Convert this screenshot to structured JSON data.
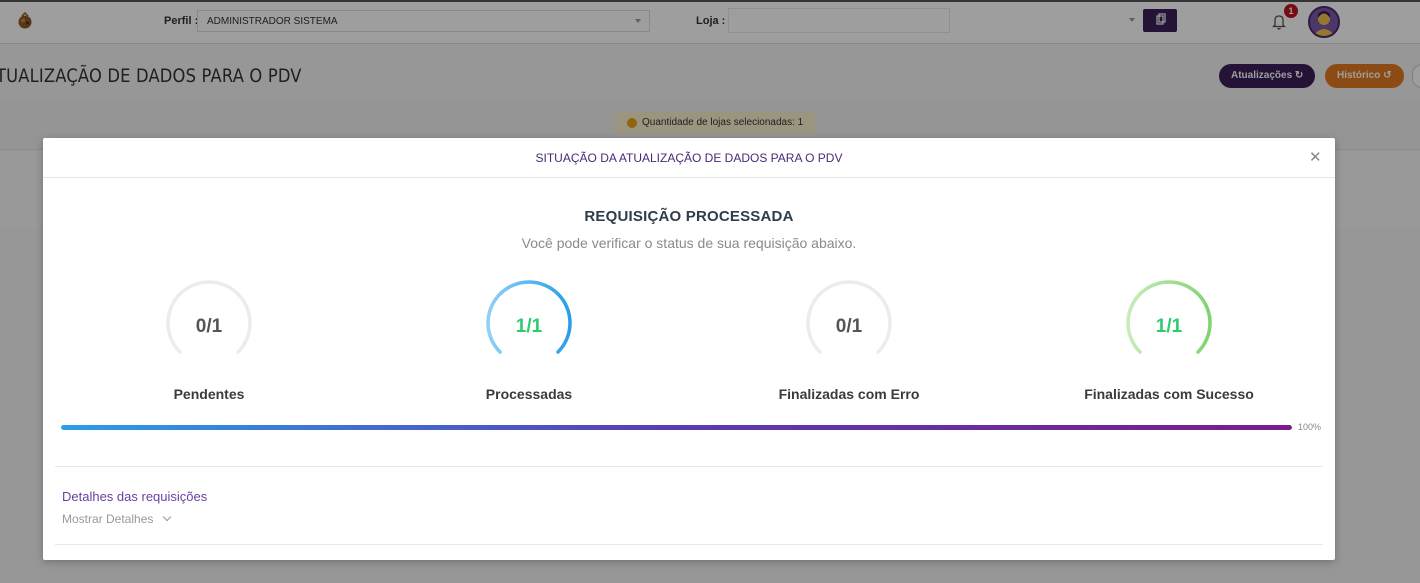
{
  "topbar": {
    "perfil_label": "Perfil :",
    "perfil_value": "ADMINISTRADOR SISTEMA",
    "loja_label": "Loja :",
    "loja_value": "",
    "notification_count": "1"
  },
  "page": {
    "title": "TUALIZAÇÃO DE DADOS PARA O PDV",
    "btn_atualizacoes": "Atualizações",
    "btn_historico": "Histórico",
    "info_chip": "Quantidade de lojas selecionadas: 1"
  },
  "modal": {
    "title": "SITUAÇÃO DA ATUALIZAÇÃO DE DADOS PARA O PDV",
    "request_title": "REQUISIÇÃO PROCESSADA",
    "request_subtitle": "Você pode verificar o status de sua requisição abaixo.",
    "gauges": [
      {
        "value": "0/1",
        "label": "Pendentes",
        "fraction": 0,
        "color": "#555555"
      },
      {
        "value": "1/1",
        "label": "Processadas",
        "fraction": 1,
        "color": "#2ecc71"
      },
      {
        "value": "0/1",
        "label": "Finalizadas com Erro",
        "fraction": 0,
        "color": "#555555"
      },
      {
        "value": "1/1",
        "label": "Finalizadas com Sucesso",
        "fraction": 1,
        "color": "#2ecc71"
      }
    ],
    "progress_percent": "100%",
    "progress_value": 100,
    "details_title": "Detalhes das requisições",
    "details_toggle": "Mostrar Detalhes"
  },
  "colors": {
    "brand_purple": "#3a1e59",
    "orange": "#e07a1f",
    "blue_arc": "#2a9ee8",
    "green_arc": "#7fd46f"
  },
  "icons": {
    "logo": "app-logo-icon",
    "copy": "copy-icon",
    "bell": "bell-icon",
    "refresh": "refresh-icon",
    "history": "history-icon",
    "close": "close-icon",
    "chevron": "chevron-down-icon",
    "info": "info-icon"
  }
}
